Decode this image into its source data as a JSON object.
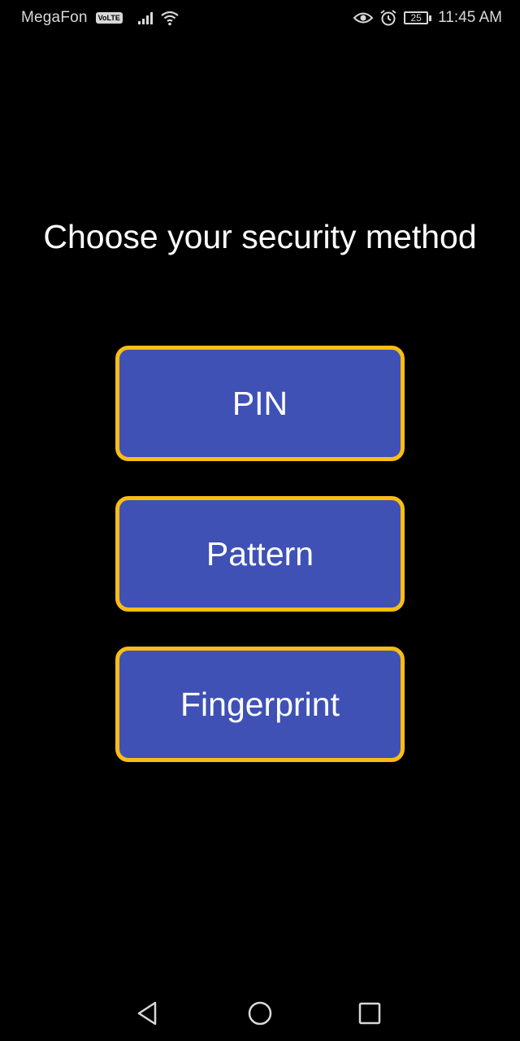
{
  "status_bar": {
    "carrier": "MegaFon",
    "volte_badge": "VoLTE",
    "battery_level": "25",
    "time": "11:45 AM",
    "icons": [
      "signal-icon",
      "wifi-icon",
      "eye-icon",
      "alarm-icon",
      "battery-icon"
    ]
  },
  "main": {
    "title": "Choose your security method",
    "buttons": [
      {
        "label": "PIN"
      },
      {
        "label": "Pattern"
      },
      {
        "label": "Fingerprint"
      }
    ]
  },
  "nav_bar": {
    "icons": [
      "back-icon",
      "home-icon",
      "recents-icon"
    ]
  },
  "colors": {
    "background": "#000000",
    "button_fill": "#3f51b5",
    "button_border": "#fbbd14",
    "text": "#ffffff"
  }
}
